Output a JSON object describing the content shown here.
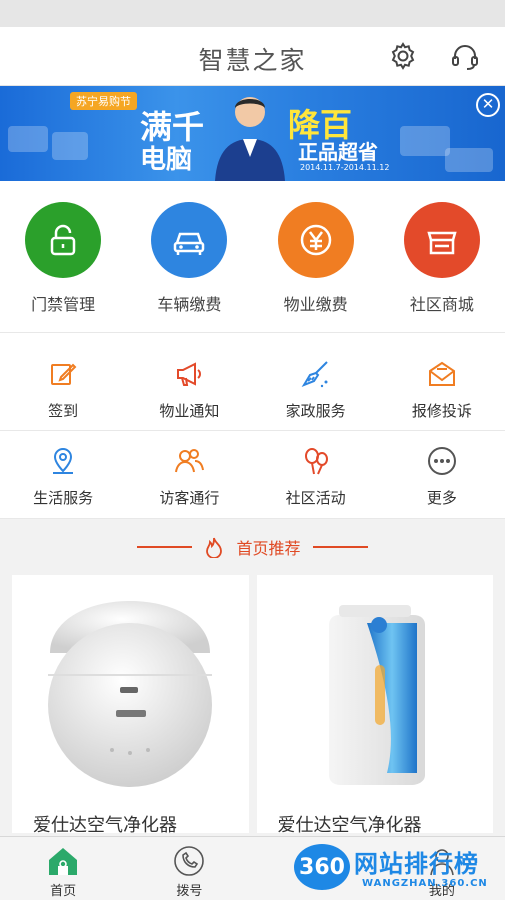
{
  "header": {
    "title": "智慧之家",
    "settings_icon": "gear-icon",
    "service_icon": "headset-icon"
  },
  "banner": {
    "tag": "苏宁易购节",
    "headline_1": "满千",
    "headline_2": "电脑",
    "headline_3": "降百",
    "headline_4": "正品超省",
    "date": "2014.11.7-2014.11.12",
    "close_icon": "close-icon"
  },
  "main_menu": [
    {
      "label": "门禁管理",
      "icon": "lock-icon",
      "color": "#2ba02b"
    },
    {
      "label": "车辆缴费",
      "icon": "car-icon",
      "color": "#2e85e0"
    },
    {
      "label": "物业缴费",
      "icon": "yen-icon",
      "color": "#f07d22"
    },
    {
      "label": "社区商城",
      "icon": "store-icon",
      "color": "#e34a2a"
    }
  ],
  "sub_menu_row1": [
    {
      "label": "签到",
      "icon": "edit-icon"
    },
    {
      "label": "物业通知",
      "icon": "megaphone-icon"
    },
    {
      "label": "家政服务",
      "icon": "broom-icon"
    },
    {
      "label": "报修投诉",
      "icon": "envelope-icon"
    }
  ],
  "sub_menu_row2": [
    {
      "label": "生活服务",
      "icon": "location-icon"
    },
    {
      "label": "访客通行",
      "icon": "visitors-icon"
    },
    {
      "label": "社区活动",
      "icon": "balloons-icon"
    },
    {
      "label": "更多",
      "icon": "more-icon"
    }
  ],
  "recommend": {
    "title": "首页推荐",
    "products": [
      {
        "name": "爱仕达空气净化器"
      },
      {
        "name": "爱仕达空气净化器"
      }
    ]
  },
  "tabbar": [
    {
      "label": "首页",
      "icon": "home-icon"
    },
    {
      "label": "拨号",
      "icon": "phone-icon"
    },
    {
      "label": "",
      "icon": ""
    },
    {
      "label": "我的",
      "icon": "user-icon"
    }
  ],
  "watermark": {
    "badge": "360",
    "title": "网站排行榜",
    "sub": "WANGZHAN.360.CN"
  }
}
